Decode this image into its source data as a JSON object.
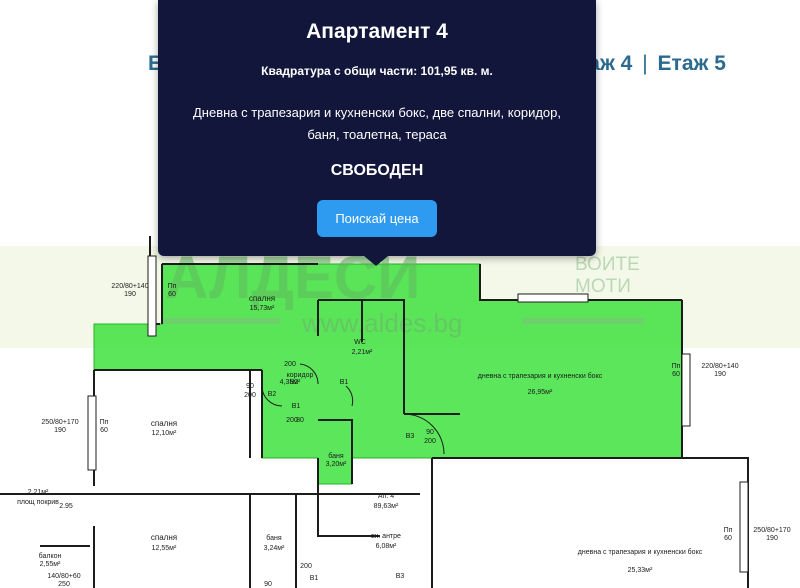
{
  "floor_nav": {
    "first_visible": "Е",
    "separator": "|",
    "floor4": "таж 4",
    "floor5": "Етаж 5"
  },
  "tooltip": {
    "title": "Апартамент 4",
    "area": "Квадратура с общи части: 101,95 кв. м.",
    "description": "Дневна с трапезария и кухненски бокс, две спални, коридор, баня, тоалетна, тераса",
    "status": "СВОБОДЕН",
    "price_button": "Поискай цена"
  },
  "watermark": {
    "brand": "АЛДЕСИ",
    "tagline_1": "ВОИТЕ",
    "tagline_2": "МОТИ",
    "url": "www.aldes.bg"
  },
  "plan": {
    "rooms": [
      {
        "name": "спалня",
        "area": "15,73м²"
      },
      {
        "name": "спалня",
        "area": "12,10м²"
      },
      {
        "name": "коридор",
        "area": "4,35м²"
      },
      {
        "name": "WC",
        "area": "2,21м²"
      },
      {
        "name": "баня",
        "area": "3,20м²"
      },
      {
        "name": "дневна с трапезария и кухненски бокс",
        "area": "26,95м²"
      },
      {
        "name": "Ап. 4",
        "area": "89,63м²"
      },
      {
        "name": "спалня",
        "area": "12,55м²"
      },
      {
        "name": "баня",
        "area": "3,24м²"
      },
      {
        "name": "вх. антре",
        "area": "6,08м²"
      },
      {
        "name": "дневна с трапезария и кухненски бокс",
        "area": "25,33м²"
      },
      {
        "name": "балкон",
        "area": "2,55м²"
      },
      {
        "name": "площ покрив",
        "area": "2,21м²"
      }
    ],
    "dims": {
      "w1": "220/80+140",
      "w1b": "190",
      "w2": "220/80+140",
      "w2b": "190",
      "w3": "250/80+170",
      "w3b": "190",
      "w4": "250/80+170",
      "w4b": "190",
      "w5": "140/80+60",
      "w5b": "250",
      "d90": "90",
      "d200": "200",
      "d80": "80",
      "pn": "Пп",
      "pn60": "60",
      "b1": "B1",
      "b2": "B2",
      "b3": "B3",
      "h295": "2.95"
    }
  },
  "colors": {
    "tooltip_bg": "#12163b",
    "button": "#2f9bf0",
    "highlight": "#3ee23e",
    "nav_text": "#2b6a8f"
  }
}
